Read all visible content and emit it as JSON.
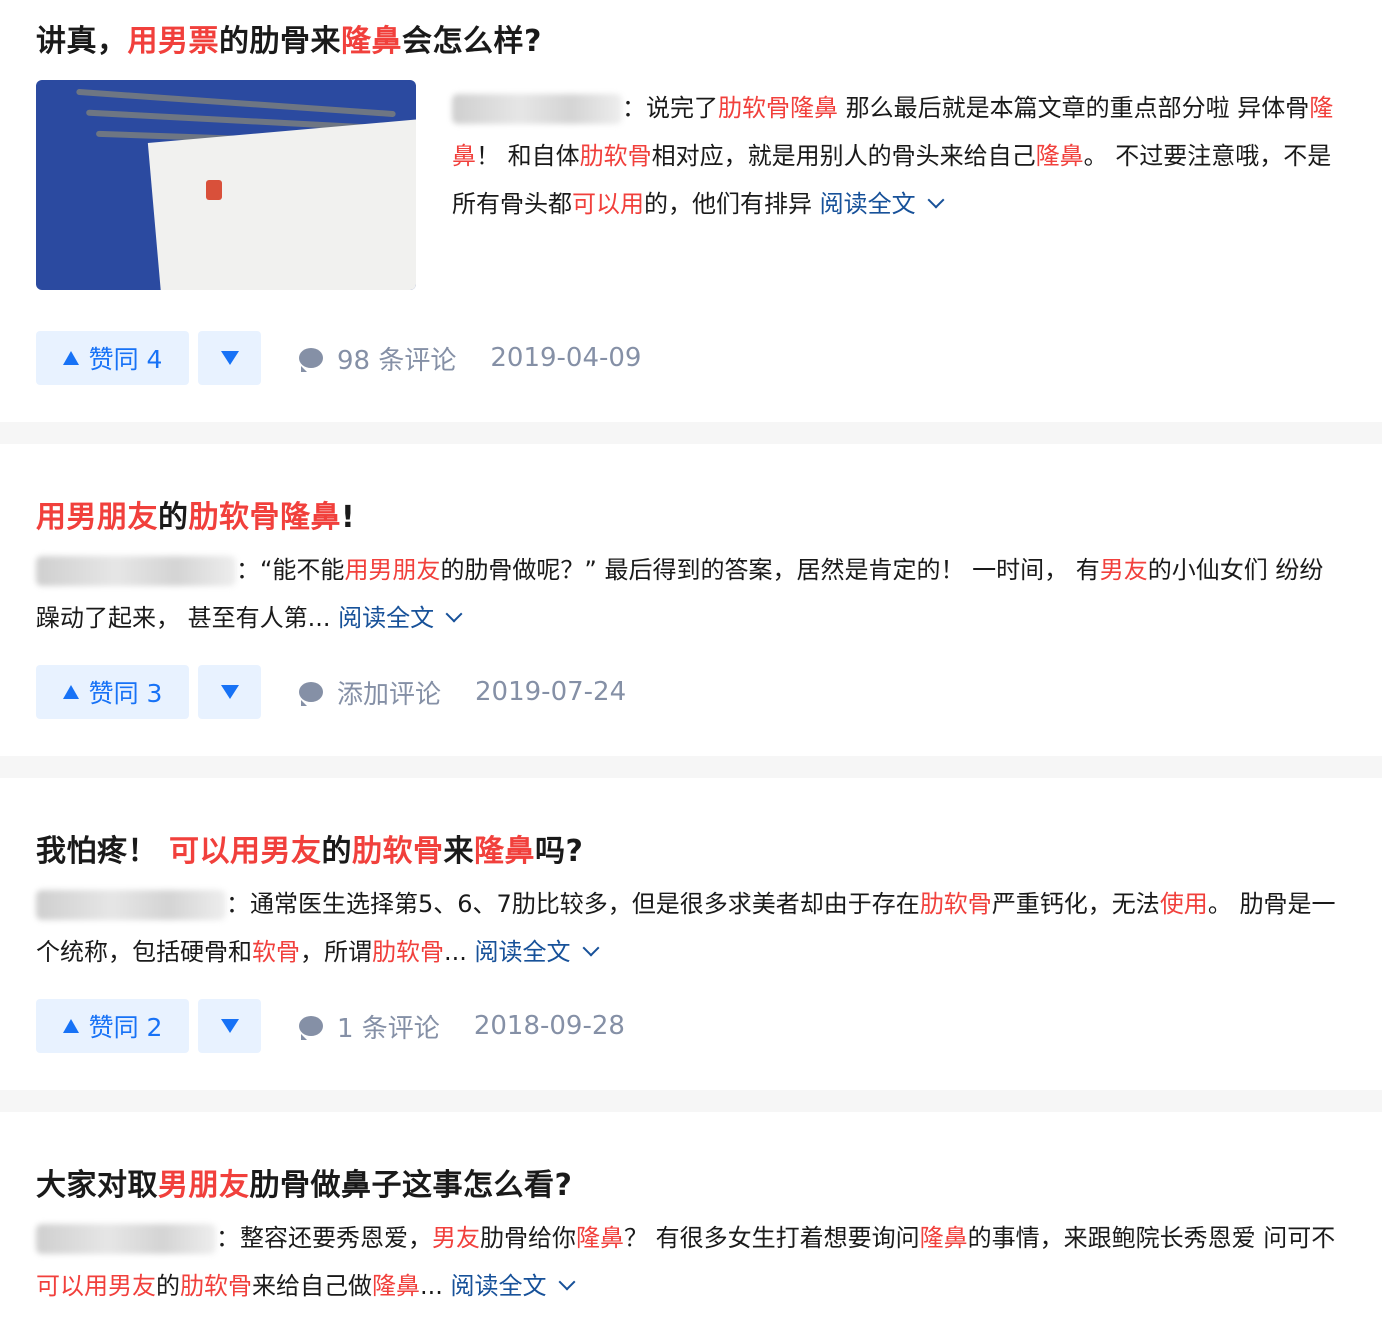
{
  "answers": [
    {
      "title": [
        {
          "t": "讲真，",
          "hl": false
        },
        {
          "t": "用男票",
          "hl": true
        },
        {
          "t": "的肋骨来",
          "hl": false
        },
        {
          "t": "隆鼻",
          "hl": true
        },
        {
          "t": "会怎么样?",
          "hl": false
        }
      ],
      "excerpt": [
        {
          "t": "：说完了",
          "hl": false
        },
        {
          "t": "肋软骨隆鼻",
          "hl": true
        },
        {
          "t": " 那么最后就是本篇文章的重点部分啦 异体骨",
          "hl": false
        },
        {
          "t": "隆鼻",
          "hl": true
        },
        {
          "t": "！ 和自体",
          "hl": false
        },
        {
          "t": "肋软骨",
          "hl": true
        },
        {
          "t": "相对应，就是用别人的骨头来给自己",
          "hl": false
        },
        {
          "t": "隆鼻",
          "hl": true
        },
        {
          "t": "。 不过要注意哦，不是所有骨头都",
          "hl": false
        },
        {
          "t": "可以用",
          "hl": true
        },
        {
          "t": "的，他们有排异 ",
          "hl": false
        }
      ],
      "read_more": "阅读全文",
      "upvote_label": "赞同 4",
      "comment_label": "98 条评论",
      "date": "2019-04-09"
    },
    {
      "title": [
        {
          "t": "用男朋友",
          "hl": true
        },
        {
          "t": "的",
          "hl": false
        },
        {
          "t": "肋软骨隆鼻",
          "hl": true
        },
        {
          "t": "!",
          "hl": false
        }
      ],
      "excerpt": [
        {
          "t": "：“能不能",
          "hl": false
        },
        {
          "t": "用男朋友",
          "hl": true
        },
        {
          "t": "的肋骨做呢？” 最后得到的答案，居然是肯定的！ 一时间， 有",
          "hl": false
        },
        {
          "t": "男友",
          "hl": true
        },
        {
          "t": "的小仙女们 纷纷躁动了起来， 甚至有人第... ",
          "hl": false
        }
      ],
      "read_more": "阅读全文",
      "upvote_label": "赞同 3",
      "comment_label": "添加评论",
      "date": "2019-07-24"
    },
    {
      "title": [
        {
          "t": "我怕疼！ ",
          "hl": false
        },
        {
          "t": "可以用男友",
          "hl": true
        },
        {
          "t": "的",
          "hl": false
        },
        {
          "t": "肋软骨",
          "hl": true
        },
        {
          "t": "来",
          "hl": false
        },
        {
          "t": "隆鼻",
          "hl": true
        },
        {
          "t": "吗?",
          "hl": false
        }
      ],
      "excerpt": [
        {
          "t": "：通常医生选择第5、6、7肋比较多，但是很多求美者却由于存在",
          "hl": false
        },
        {
          "t": "肋软骨",
          "hl": true
        },
        {
          "t": "严重钙化，无法",
          "hl": false
        },
        {
          "t": "使用",
          "hl": true
        },
        {
          "t": "。 肋骨是一个统称，包括硬骨和",
          "hl": false
        },
        {
          "t": "软骨",
          "hl": true
        },
        {
          "t": "，所谓",
          "hl": false
        },
        {
          "t": "肋软骨",
          "hl": true
        },
        {
          "t": "... ",
          "hl": false
        }
      ],
      "read_more": "阅读全文",
      "upvote_label": "赞同 2",
      "comment_label": "1 条评论",
      "date": "2018-09-28"
    },
    {
      "title": [
        {
          "t": "大家对取",
          "hl": false
        },
        {
          "t": "男朋友",
          "hl": true
        },
        {
          "t": "肋骨做鼻子这事怎么看?",
          "hl": false
        }
      ],
      "excerpt": [
        {
          "t": "：整容还要秀恩爱，",
          "hl": false
        },
        {
          "t": "男友",
          "hl": true
        },
        {
          "t": "肋骨给你",
          "hl": false
        },
        {
          "t": "隆鼻",
          "hl": true
        },
        {
          "t": "？ 有很多女生打着想要询问",
          "hl": false
        },
        {
          "t": "隆鼻",
          "hl": true
        },
        {
          "t": "的事情，来跟鲍院长秀恩爱 问可不",
          "hl": false
        },
        {
          "t": "可以用男友",
          "hl": true
        },
        {
          "t": "的",
          "hl": false
        },
        {
          "t": "肋软骨",
          "hl": true
        },
        {
          "t": "来给自己做",
          "hl": false
        },
        {
          "t": "隆鼻",
          "hl": true
        },
        {
          "t": "... ",
          "hl": false
        }
      ],
      "read_more": "阅读全文"
    }
  ]
}
